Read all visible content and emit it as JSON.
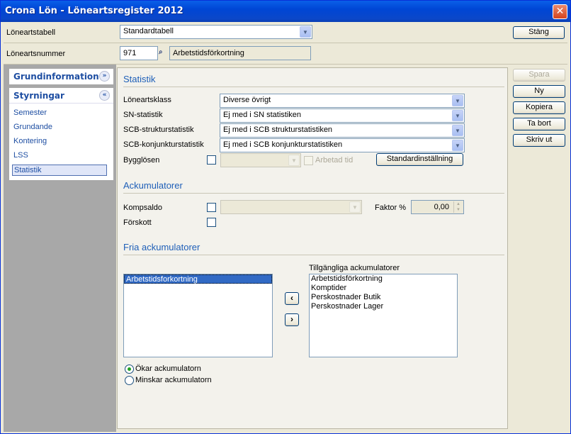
{
  "window": {
    "title": "Crona Lön - Löneartsregister 2012",
    "close_glyph": "✕"
  },
  "header": {
    "loneartstabell_label": "Löneartstabell",
    "loneartstabell_value": "Standardtabell",
    "stang_label": "Stäng",
    "loneartsnummer_label": "Löneartsnummer",
    "loneartsnummer_value": "971",
    "loneart_name": "Arbetstidsförkortning"
  },
  "sidebar": {
    "group1": "Grundinformation",
    "group2": "Styrningar",
    "items": [
      {
        "label": "Semester"
      },
      {
        "label": "Grundande"
      },
      {
        "label": "Kontering"
      },
      {
        "label": "LSS"
      },
      {
        "label": "Statistik",
        "selected": true
      }
    ]
  },
  "actions": {
    "spara": "Spara",
    "ny": "Ny",
    "kopiera": "Kopiera",
    "tabort": "Ta bort",
    "skrivut": "Skriv ut"
  },
  "statistik": {
    "title": "Statistik",
    "loneartsklass_label": "Löneartsklass",
    "loneartsklass_value": "Diverse övrigt",
    "sn_label": "SN-statistik",
    "sn_value": "Ej med i SN statistiken",
    "scb_struktur_label": "SCB-strukturstatistik",
    "scb_struktur_value": "Ej med i SCB strukturstatistiken",
    "scb_konj_label": "SCB-konjunkturstatistik",
    "scb_konj_value": "Ej med i SCB konjunkturstatistiken",
    "bygglosen_label": "Bygglösen",
    "arbetad_tid_label": "Arbetad tid",
    "standard_button": "Standardinställning"
  },
  "ackumulatorer": {
    "title": "Ackumulatorer",
    "kompsaldo_label": "Kompsaldo",
    "forskott_label": "Förskott",
    "faktor_label": "Faktor %",
    "faktor_value": "0,00"
  },
  "fria": {
    "title": "Fria ackumulatorer",
    "selected": [
      "Arbetstidsforkortning"
    ],
    "available_label": "Tillgängliga ackumulatorer",
    "available": [
      "Arbetstidsförkortning",
      "Komptider",
      "Perskostnader Butik",
      "Perskostnader Lager"
    ],
    "radio_okar": "Ökar ackumulatorn",
    "radio_minskar": "Minskar ackumulatorn"
  },
  "colors": {
    "accent": "#1e5fb8",
    "selection": "#316ac5"
  }
}
